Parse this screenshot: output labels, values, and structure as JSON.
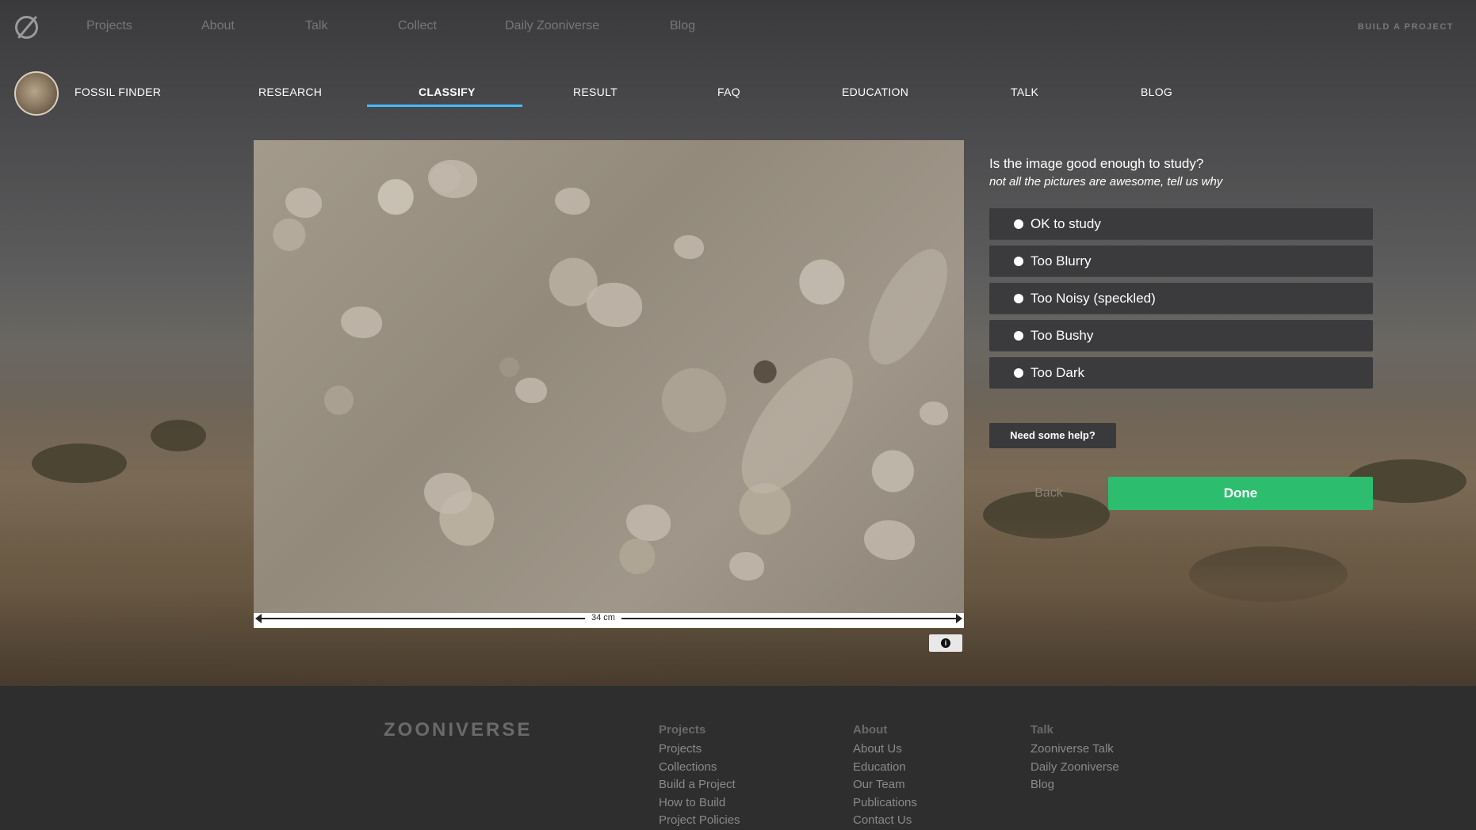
{
  "topnav": {
    "links": [
      "Projects",
      "About",
      "Talk",
      "Collect",
      "Daily Zooniverse",
      "Blog"
    ],
    "build": "BUILD A PROJECT"
  },
  "project": {
    "title": "FOSSIL FINDER",
    "tabs": [
      "RESEARCH",
      "CLASSIFY",
      "RESULT",
      "FAQ",
      "EDUCATION",
      "TALK",
      "BLOG"
    ],
    "active_tab": "CLASSIFY"
  },
  "subject": {
    "scale_label": "34 cm"
  },
  "task": {
    "question": "Is the image good enough to study?",
    "help_text": "not all the pictures are awesome, tell us why",
    "answers": [
      "OK to study",
      "Too Blurry",
      "Too Noisy (speckled)",
      "Too Bushy",
      "Too Dark"
    ],
    "need_help": "Need some help?",
    "back": "Back",
    "done": "Done",
    "done_color": "#2dbd6e"
  },
  "footer": {
    "logo": "ZOONIVERSE",
    "columns": [
      {
        "heading": "Projects",
        "links": [
          "Projects",
          "Collections",
          "Build a Project",
          "How to Build",
          "Project Policies"
        ]
      },
      {
        "heading": "About",
        "links": [
          "About Us",
          "Education",
          "Our Team",
          "Publications",
          "Contact Us"
        ]
      },
      {
        "heading": "Talk",
        "links": [
          "Zooniverse Talk",
          "Daily Zooniverse",
          "Blog"
        ]
      }
    ]
  },
  "colors": {
    "accent_underline": "#43bbfd",
    "footer_bg": "#2e2e2f"
  }
}
